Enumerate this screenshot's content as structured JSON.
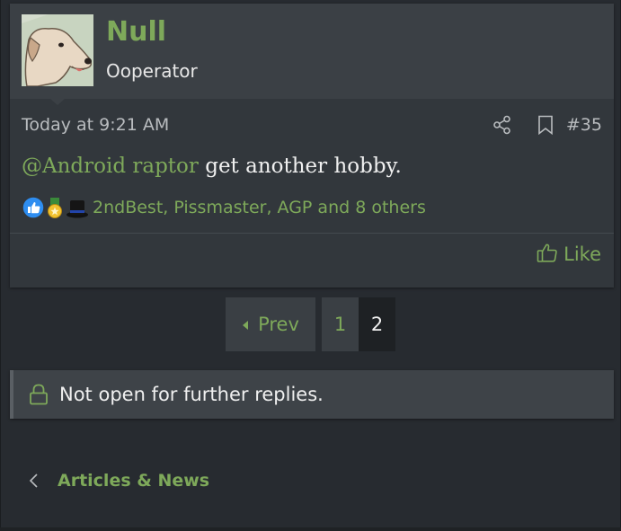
{
  "post": {
    "author": {
      "name": "Null",
      "title": "Ooperator",
      "avatar_icon": "dog-avatar-icon"
    },
    "timestamp": "Today at 9:21 AM",
    "post_number": "#35",
    "actions": {
      "share_icon": "share-icon",
      "bookmark_icon": "bookmark-icon"
    },
    "message": {
      "mention": "@Android raptor",
      "text": " get another hobby."
    },
    "reactions": {
      "icons": [
        "thumbs-up-icon",
        "medal-icon",
        "top-hat-icon"
      ],
      "summary": "2ndBest, Pissmaster, AGP and 8 others"
    },
    "like_label": "Like"
  },
  "pagination": {
    "prev_label": "Prev",
    "pages": [
      "1",
      "2"
    ],
    "current": "2"
  },
  "locked_notice": {
    "text": "Not open for further replies."
  },
  "breadcrumb": {
    "label": "Articles & News"
  },
  "colors": {
    "accent": "#7ea95a",
    "background": "#272b30",
    "card": "#32373c",
    "header": "#3b4045"
  }
}
